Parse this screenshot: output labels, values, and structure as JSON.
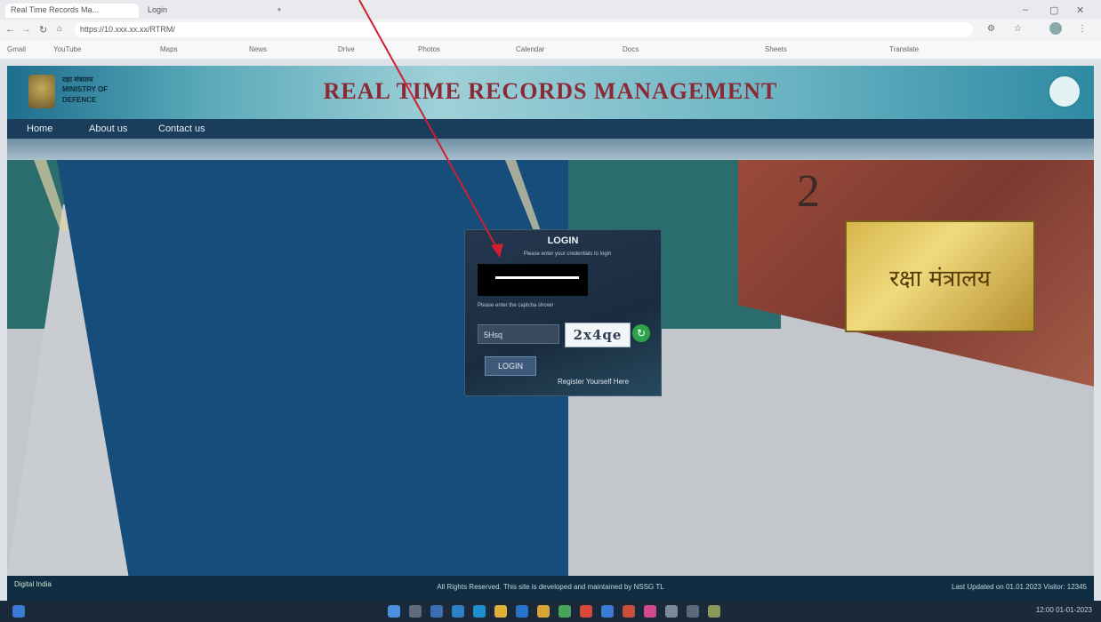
{
  "browser": {
    "tabs": [
      "Real Time Records Ma...",
      "Login"
    ],
    "new_tab": "+",
    "url": "https://10.xxx.xx.xx/RTRM/",
    "bookmarks": [
      "Gmail",
      "YouTube",
      "Maps",
      "News",
      "Drive",
      "Photos",
      "Calendar",
      "Docs",
      "Sheets",
      "Translate"
    ]
  },
  "site": {
    "logo_lines": [
      "रक्षा मंत्रालय",
      "MINISTRY OF",
      "DEFENCE"
    ],
    "title": "REAL TIME RECORDS MANAGEMENT",
    "nav": [
      "Home",
      "About us",
      "Contact us"
    ]
  },
  "hero": {
    "plaque_text": "रक्षा मंत्रालय",
    "building_number": "2"
  },
  "login": {
    "title": "LOGIN",
    "hint": "Please enter your credentials to login",
    "password_label": "Please enter the captcha shown",
    "captcha_value": "5Hsq",
    "captcha_image_text": "2x4qe",
    "refresh_icon": "↻",
    "button": "LOGIN",
    "register": "Register Yourself Here"
  },
  "footer": {
    "logo": "Digital India",
    "text": "All Rights Reserved. This site is developed and maintained by NSSG TL",
    "right": "Last Updated on 01.01.2023 Visitor: 12345"
  },
  "taskbar": {
    "time": "12:00",
    "date": "01-01-2023"
  },
  "colors": {
    "title": "#8a2a34",
    "nav": "#1b3d5c",
    "login_bg": "#1f3247",
    "arrow": "#d02030"
  }
}
